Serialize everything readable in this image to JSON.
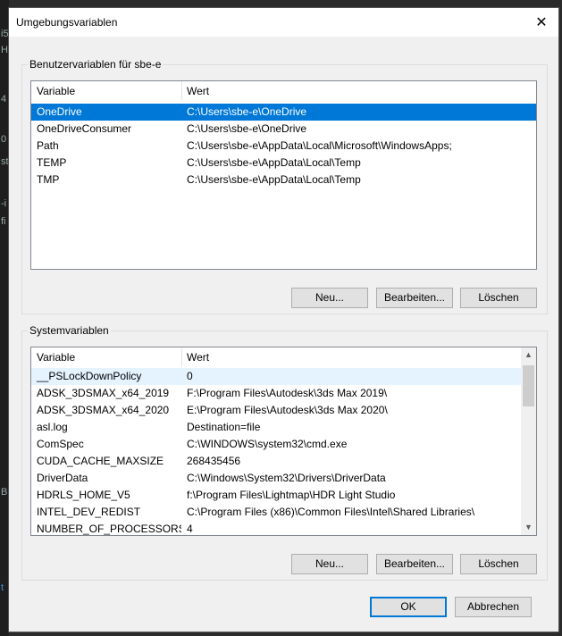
{
  "dialog": {
    "title": "Umgebungsvariablen",
    "close_symbol": "✕"
  },
  "background": {
    "fragments": [
      "i5",
      "Hz",
      "4",
      "0",
      "st",
      "-i",
      "fi",
      "B",
      "t"
    ]
  },
  "user_vars": {
    "group_label": "Benutzervariablen für sbe-e",
    "col_variable": "Variable",
    "col_value": "Wert",
    "rows": [
      {
        "name": "OneDrive",
        "value": "C:\\Users\\sbe-e\\OneDrive"
      },
      {
        "name": "OneDriveConsumer",
        "value": "C:\\Users\\sbe-e\\OneDrive"
      },
      {
        "name": "Path",
        "value": "C:\\Users\\sbe-e\\AppData\\Local\\Microsoft\\WindowsApps;"
      },
      {
        "name": "TEMP",
        "value": "C:\\Users\\sbe-e\\AppData\\Local\\Temp"
      },
      {
        "name": "TMP",
        "value": "C:\\Users\\sbe-e\\AppData\\Local\\Temp"
      }
    ],
    "selected_index": 0,
    "new_label": "Neu...",
    "edit_label": "Bearbeiten...",
    "delete_label": "Löschen"
  },
  "system_vars": {
    "group_label": "Systemvariablen",
    "col_variable": "Variable",
    "col_value": "Wert",
    "rows": [
      {
        "name": "__PSLockDownPolicy",
        "value": "0"
      },
      {
        "name": "ADSK_3DSMAX_x64_2019",
        "value": "F:\\Program Files\\Autodesk\\3ds Max 2019\\"
      },
      {
        "name": "ADSK_3DSMAX_x64_2020",
        "value": "E:\\Program Files\\Autodesk\\3ds Max 2020\\"
      },
      {
        "name": "asl.log",
        "value": "Destination=file"
      },
      {
        "name": "ComSpec",
        "value": "C:\\WINDOWS\\system32\\cmd.exe"
      },
      {
        "name": "CUDA_CACHE_MAXSIZE",
        "value": "268435456"
      },
      {
        "name": "DriverData",
        "value": "C:\\Windows\\System32\\Drivers\\DriverData"
      },
      {
        "name": "HDRLS_HOME_V5",
        "value": "f:\\Program Files\\Lightmap\\HDR Light Studio"
      },
      {
        "name": "INTEL_DEV_REDIST",
        "value": "C:\\Program Files (x86)\\Common Files\\Intel\\Shared Libraries\\"
      },
      {
        "name": "NUMBER_OF_PROCESSORS",
        "value": "4"
      }
    ],
    "hover_index": 0,
    "new_label": "Neu...",
    "edit_label": "Bearbeiten...",
    "delete_label": "Löschen"
  },
  "footer": {
    "ok_label": "OK",
    "cancel_label": "Abbrechen"
  }
}
